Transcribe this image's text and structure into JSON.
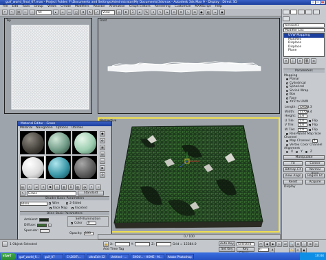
{
  "window": {
    "title": "guif_world_final_07.max - Project Folder: F:\\Documents and Settings\\Administrator\\My Documents\\3dsmax - Autodesk 3ds Max 9 - Display : Direct 3D"
  },
  "menu": [
    "File",
    "Edit",
    "Tools",
    "Group",
    "Views",
    "Create",
    "Modifiers",
    "Reactor",
    "Animation",
    "Graph Editors",
    "Rendering",
    "Customize",
    "MAXScript",
    "Help"
  ],
  "toolbar": {
    "selection_filter": "All",
    "view_dropdown": "View"
  },
  "viewports": {
    "top": "Top",
    "front": "Front",
    "perspective": "Perspective"
  },
  "command_panel": {
    "object_name": "terrain01",
    "modifier_list": "Modifier List",
    "stack": [
      "UVW Mapping",
      "MultiRes",
      "Displace",
      "Displace",
      "Plane"
    ],
    "parameters_title": "Parameters",
    "mapping_label": "Mapping",
    "mapping_options": [
      "Planar",
      "Cylindrical",
      "Spherical",
      "Shrink Wrap",
      "Box",
      "Face",
      "XYZ to UVW"
    ],
    "mapping_selected": 0,
    "cap_label": "Cap",
    "length_label": "Length:",
    "length_value": "12023.3",
    "width_label": "Width:",
    "width_value": "11729.4",
    "height_label": "Height:",
    "height_value": "1.0",
    "utile_label": "U Tile:",
    "utile_value": "1.0",
    "vtile_label": "V Tile:",
    "vtile_value": "1.0",
    "wtile_label": "W Tile:",
    "wtile_value": "1.0",
    "flip_label": "Flip",
    "real_world": "Real-World Map Size",
    "channel_label": "Channel",
    "map_channel_label": "Map Channel:",
    "map_channel_value": "1",
    "vertex_color_channel": "Vertex Color Channel",
    "alignment_label": "Alignment",
    "axes": [
      "X",
      "Y",
      "Z"
    ],
    "manipulate": "Manipulate",
    "fit": "Fit",
    "center": "Center",
    "bitmap_fit": "Bitmap Fit",
    "normal_align": "Normal Align",
    "view_align": "View Align",
    "region_fit": "Region Fit",
    "reset": "Reset",
    "acquire": "Acquire",
    "display_label": "Display"
  },
  "material_editor": {
    "title": "Material Editor - Grass",
    "menu": [
      "Material",
      "Navigation",
      "Options",
      "Utilities"
    ],
    "material_name": "Grass",
    "material_type": "Standard",
    "shader_basic": "Shader Basic Parameters",
    "shader_type": "Blinn",
    "wire": "Wire",
    "two_sided": "2-Sided",
    "face_map": "Face Map",
    "faceted": "Faceted",
    "blinn_basic": "Blinn Basic Parameters",
    "self_illum": "Self-Illumination",
    "ambient": "Ambient:",
    "diffuse": "Diffuse:",
    "specular": "Specular:",
    "color": "Color",
    "color_value": "0",
    "opacity": "Opacity:",
    "opacity_value": "100",
    "specular_highlights": "Specular Highlights"
  },
  "timeline": {
    "frame": "0 / 100"
  },
  "status": {
    "selected_count": "1 Object Selected",
    "grid": "Grid = 10.0",
    "x_label": "X:",
    "y_label": "Y:",
    "z_label": "Z:",
    "grid_value": "Grid = 15384.0",
    "auto_key": "Auto Key",
    "set_key": "Set Key",
    "selected_dropdown": "Selected",
    "key_filters": "Key Filters...",
    "add_time_tag": "Add Time Tag",
    "frame_value": "0"
  },
  "taskbar": {
    "start": "start",
    "tasks": [
      "guif_world_fi...",
      "guif_07",
      "C:\\2007\\...",
      "ultraEdit-32",
      "Untitled - ...",
      "SHOU... - HOME - M...",
      "Adobe Photoshop"
    ],
    "clock": "10:44"
  },
  "colors": {
    "accent": "#1c3f9e",
    "grass": "#2f5a2a",
    "viewport_bg": "#9ea4aa"
  }
}
